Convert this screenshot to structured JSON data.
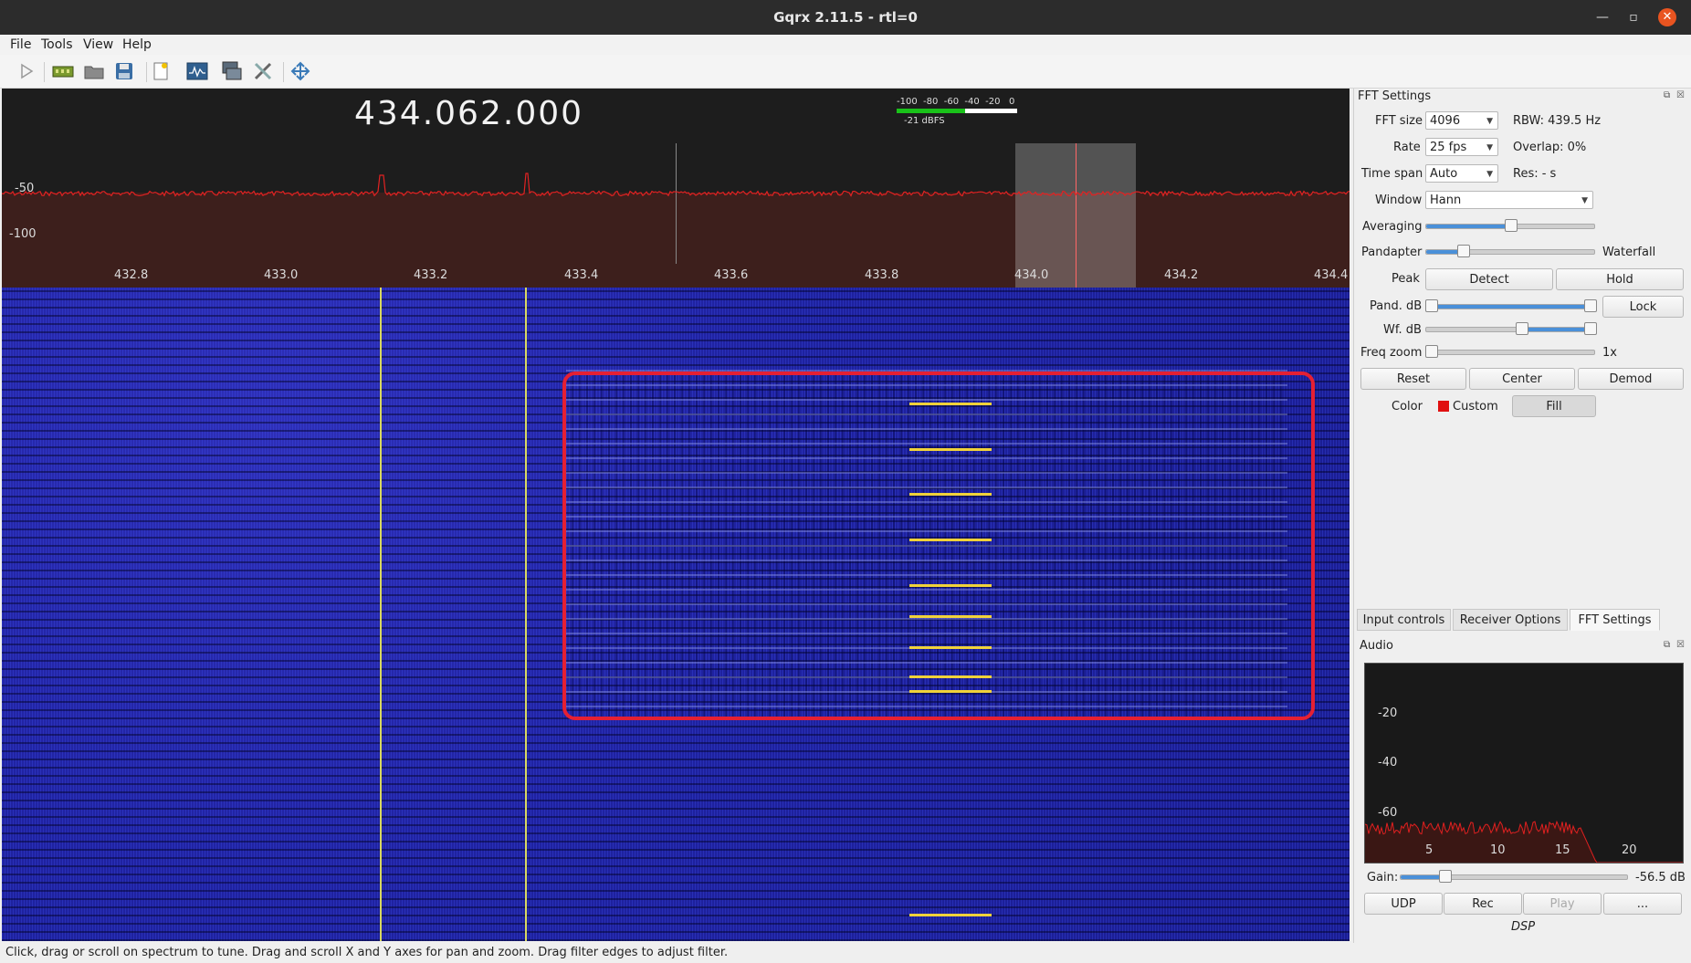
{
  "window": {
    "title": "Gqrx 2.11.5 - rtl=0"
  },
  "menu": {
    "file": "File",
    "tools": "Tools",
    "view": "View",
    "help": "Help"
  },
  "toolbar": {
    "icons": [
      "play-icon",
      "device-icon",
      "open-icon",
      "save-icon",
      "bookmark-icon",
      "waveform-icon",
      "remote-control-icon",
      "settings-icon",
      "fullscreen-icon"
    ]
  },
  "spectrum": {
    "frequency": "434.062.000",
    "db_labels": [
      "-50",
      "-100"
    ],
    "freq_ticks": [
      "432.8",
      "433.0",
      "433.2",
      "433.4",
      "433.6",
      "433.8",
      "434.0",
      "434.2",
      "434.4"
    ],
    "meter_scale": "-100  -80  -60  -40  -20   0",
    "meter_reading": "-21 dBFS",
    "meter_level_pct": 57,
    "trace_color": "#e12222"
  },
  "fft": {
    "panel_title": "FFT Settings",
    "fft_size_label": "FFT size",
    "fft_size": "4096",
    "rbw": "RBW: 439.5 Hz",
    "rate_label": "Rate",
    "rate": "25 fps",
    "overlap": "Overlap: 0%",
    "timespan_label": "Time span",
    "timespan": "Auto",
    "res": "Res: - s",
    "window_label": "Window",
    "window": "Hann",
    "averaging_label": "Averaging",
    "averaging_pct": 50,
    "pandapter_label": "Pandapter",
    "waterfall_label": "Waterfall",
    "pandapter_pct": 20,
    "peak_label": "Peak",
    "detect": "Detect",
    "hold": "Hold",
    "pand_db_label": "Pand. dB",
    "lock": "Lock",
    "wf_db_label": "Wf. dB",
    "freq_zoom_label": "Freq zoom",
    "freq_zoom_value": "1x",
    "reset": "Reset",
    "center": "Center",
    "demod": "Demod",
    "color_label": "Color",
    "color_name": "Custom",
    "fill": "Fill",
    "color_swatch": "#e01010"
  },
  "tabs": [
    "Input controls",
    "Receiver Options",
    "FFT Settings"
  ],
  "audio": {
    "panel_title": "Audio",
    "y_labels": [
      "-20",
      "-40",
      "-60"
    ],
    "x_labels": [
      "5",
      "10",
      "15",
      "20"
    ],
    "gain_label": "Gain:",
    "gain_value": "-56.5 dB",
    "gain_pct": 18,
    "udp": "UDP",
    "rec": "Rec",
    "play": "Play",
    "more": "...",
    "dsp": "DSP"
  },
  "status": {
    "text": "Click, drag or scroll on spectrum to tune. Drag and scroll X and Y axes for pan and zoom. Drag filter edges to adjust filter."
  }
}
